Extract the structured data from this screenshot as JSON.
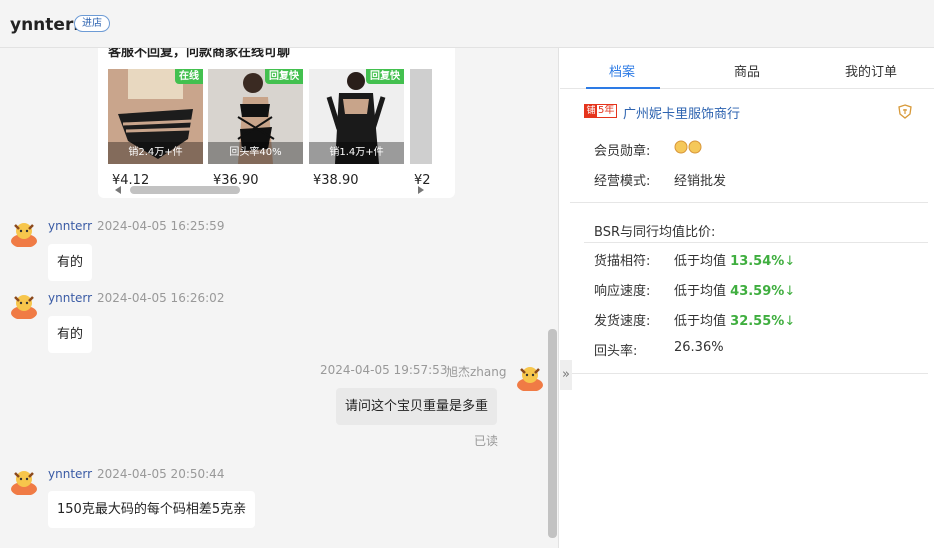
{
  "header": {
    "name": "ynnterr",
    "badge": "进店"
  },
  "card": {
    "title": "客服不回复，问款商家在线可聊",
    "products": [
      {
        "tag": "在线",
        "caption": "销2.4万+件",
        "price": "¥4.12"
      },
      {
        "tag": "回复快",
        "caption": "回头率40%",
        "price": "¥36.90"
      },
      {
        "tag": "回复快",
        "caption": "销1.4万+件",
        "price": "¥38.90"
      },
      {
        "tag": "",
        "caption": "",
        "price": "¥2"
      }
    ]
  },
  "messages": [
    {
      "name": "ynnterr",
      "time": "2024-04-05 16:25:59",
      "text": "有的"
    },
    {
      "name": "ynnterr",
      "time": "2024-04-05 16:26:02",
      "text": "有的"
    },
    {
      "name": "旭杰zhang",
      "time": "2024-04-05 19:57:53",
      "text": "请问这个宝贝重量是多重",
      "status": "已读"
    },
    {
      "name": "ynnterr",
      "time": "2024-04-05 20:50:44",
      "text": "150克最大码的每个码相差5克亲"
    }
  ],
  "panel": {
    "tabs": [
      "档案",
      "商品",
      "我的订单"
    ],
    "shop": {
      "years_icon": "铺",
      "years": "5年",
      "name": "广州妮卡里服饰商行"
    },
    "info": [
      {
        "label": "会员勋章:",
        "value": ""
      },
      {
        "label": "经营模式:",
        "value": "经销批发"
      }
    ],
    "bsr_title": "BSR与同行均值比价:",
    "bsr": [
      {
        "label": "货描相符:",
        "prefix": "低于均值",
        "value": "13.54%",
        "arrow": "↓"
      },
      {
        "label": "响应速度:",
        "prefix": "低于均值",
        "value": "43.59%",
        "arrow": "↓"
      },
      {
        "label": "发货速度:",
        "prefix": "低于均值",
        "value": "32.55%",
        "arrow": "↓"
      },
      {
        "label": "回头率:",
        "prefix": "26.36%",
        "value": "",
        "arrow": ""
      }
    ]
  },
  "colors": {
    "accent": "#2d7be5",
    "green": "#3fae3f",
    "shop_badge": "#e5341c"
  }
}
